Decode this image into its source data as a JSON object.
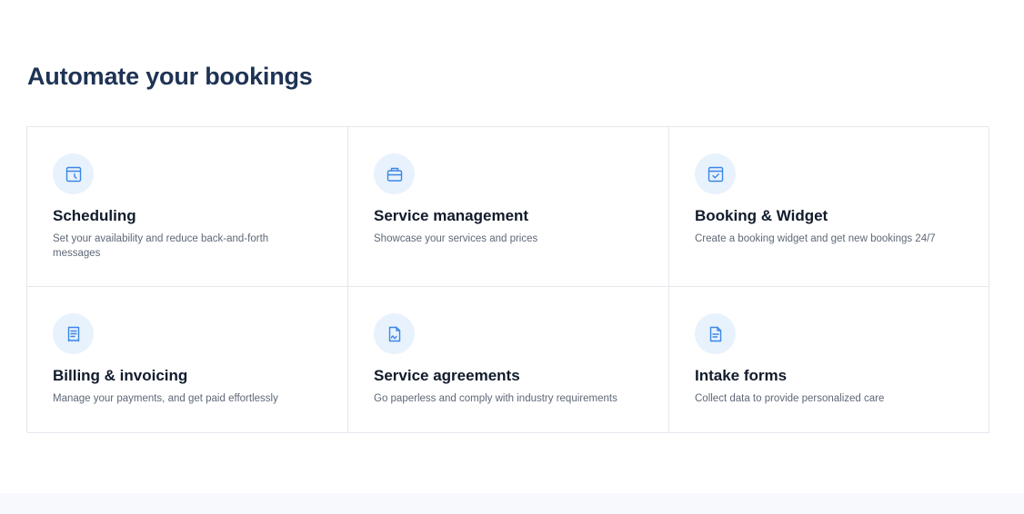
{
  "section": {
    "title": "Automate your bookings"
  },
  "colors": {
    "heading": "#1e3354",
    "card_title": "#111b2b",
    "description": "#5f6877",
    "icon_bg": "#e8f2fd",
    "icon_stroke": "#3b86e6",
    "border": "#e4e7ec"
  },
  "features": [
    {
      "icon": "calendar-clock-icon",
      "title": "Scheduling",
      "description": "Set your availability and reduce back-and-forth messages"
    },
    {
      "icon": "briefcase-icon",
      "title": "Service management",
      "description": "Showcase your services and prices"
    },
    {
      "icon": "calendar-check-icon",
      "title": "Booking & Widget",
      "description": "Create a booking widget and get new bookings 24/7"
    },
    {
      "icon": "receipt-icon",
      "title": "Billing & invoicing",
      "description": "Manage your payments, and get paid effortlessly"
    },
    {
      "icon": "signed-document-icon",
      "title": "Service agreements",
      "description": "Go paperless and comply with industry requirements"
    },
    {
      "icon": "form-document-icon",
      "title": "Intake forms",
      "description": "Collect data to provide personalized care"
    }
  ]
}
